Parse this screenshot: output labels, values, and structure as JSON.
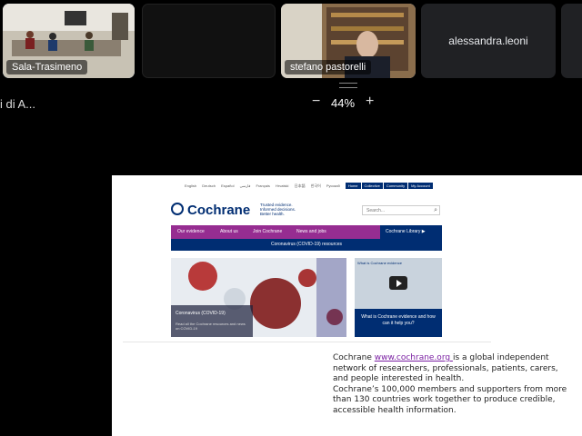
{
  "participants": [
    {
      "name": "Sala-Trasimeno",
      "active": true
    },
    {
      "name": "",
      "active": false
    },
    {
      "name": "stefano pastorelli",
      "active": true
    },
    {
      "name": "alessandra.leoni",
      "active": false
    }
  ],
  "toolbar": {
    "doc_title": "i di A...",
    "zoom_minus": "−",
    "zoom_value": "44%",
    "zoom_plus": "+"
  },
  "site": {
    "topbar_links": [
      "English",
      "Deutsch",
      "Español",
      "فارسی",
      "Français",
      "Hrvatski",
      "日本語",
      "한국어",
      "Русский"
    ],
    "topbar_buttons": [
      "Home",
      "Collective",
      "Community",
      "My Account"
    ],
    "logo": "Cochrane",
    "tagline": "Trusted evidence. Informed decisions. Better health.",
    "search_placeholder": "Search...",
    "nav": [
      "Our evidence",
      "About us",
      "Join Cochrane",
      "News and jobs"
    ],
    "library": "Cochrane Library ▶",
    "covid_bar": "Coronavirus (COVID-19) resources",
    "hero_caption": "Coronavirus (COVID-19)",
    "hero_sub": "Read all the Cochrane resources and news on COVID-19",
    "video_title": "What is Cochrane evidence",
    "video_caption": "What is Cochrane evidence and how can it help you?"
  },
  "note": {
    "prefix": "Cochrane ",
    "link": "www.cochrane.org ",
    "line1_rest": "is a global independent network of researchers, professionals, patients, carers, and people interested in health.",
    "line2": " Cochrane’s 100,000 members and supporters from more than 130 countries  work together to produce credible, accessible health information."
  },
  "colors": {
    "purple": "#962d91",
    "navy": "#002d72",
    "tile_border": "#7aa8e6"
  }
}
